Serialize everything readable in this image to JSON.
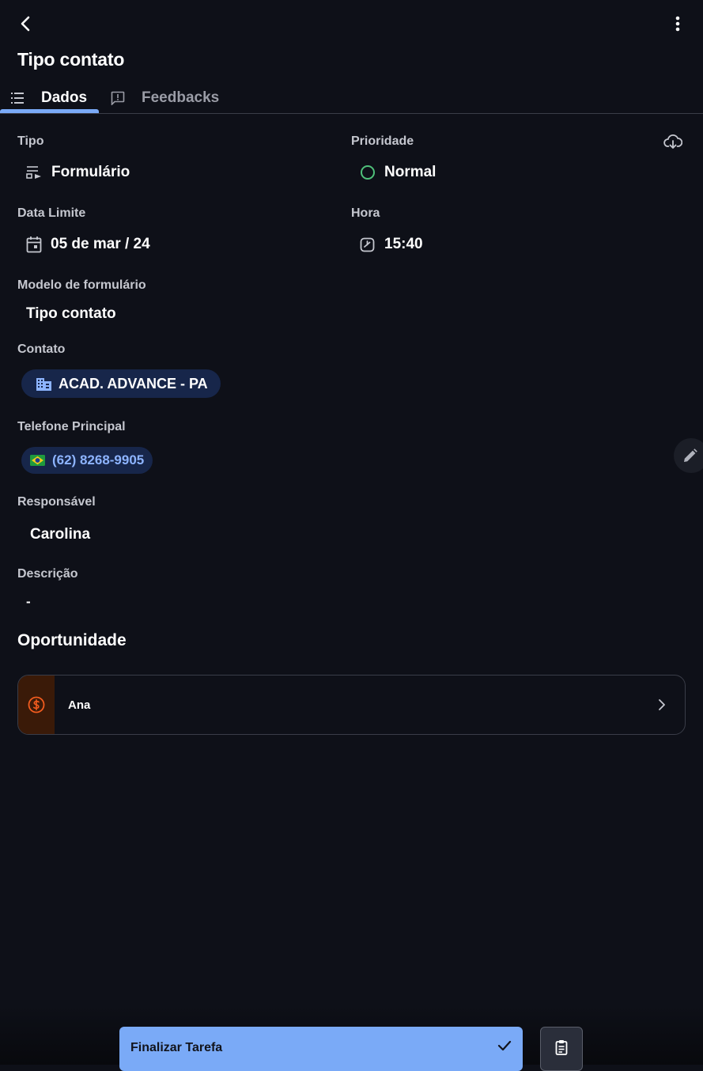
{
  "header": {
    "title": "Tipo contato",
    "back_icon": "chevron-left-icon",
    "menu_icon": "more-vertical-icon"
  },
  "tabs": [
    {
      "label": "Dados",
      "icon": "list-icon",
      "active": true
    },
    {
      "label": "Feedbacks",
      "icon": "feedback-icon",
      "active": false
    }
  ],
  "fields": {
    "tipo": {
      "label": "Tipo",
      "value": "Formulário",
      "icon": "form-icon"
    },
    "prioridade": {
      "label": "Prioridade",
      "value": "Normal",
      "icon": "circle-outline-icon",
      "color": "#4fc07a"
    },
    "data_limite": {
      "label": "Data Limite",
      "value": "05 de mar / 24",
      "icon": "calendar-icon"
    },
    "hora": {
      "label": "Hora",
      "value": "15:40",
      "icon": "clock-icon"
    },
    "modelo": {
      "label": "Modelo de formulário",
      "value": "Tipo contato"
    },
    "contato": {
      "label": "Contato",
      "value": "ACAD. ADVANCE - PA",
      "icon": "building-icon"
    },
    "telefone": {
      "label": "Telefone Principal",
      "value": "(62) 8268-9905",
      "icon": "brazil-flag-icon"
    },
    "responsavel": {
      "label": "Responsável",
      "value": "Carolina"
    },
    "descricao": {
      "label": "Descrição",
      "value": "-"
    }
  },
  "oportunidade": {
    "title": "Oportunidade",
    "items": [
      {
        "name": "Ana",
        "icon": "dollar-circle-icon",
        "accent": "#f25c1e"
      }
    ]
  },
  "actions": {
    "finish_label": "Finalizar Tarefa",
    "finish_icon": "check-icon",
    "clipboard_icon": "clipboard-icon",
    "download_icon": "cloud-download-icon",
    "edit_icon": "pencil-icon"
  },
  "colors": {
    "background": "#0e1018",
    "accent": "#7aaaf7",
    "chip_background": "#17264a",
    "phone_text": "#8db4ff"
  }
}
